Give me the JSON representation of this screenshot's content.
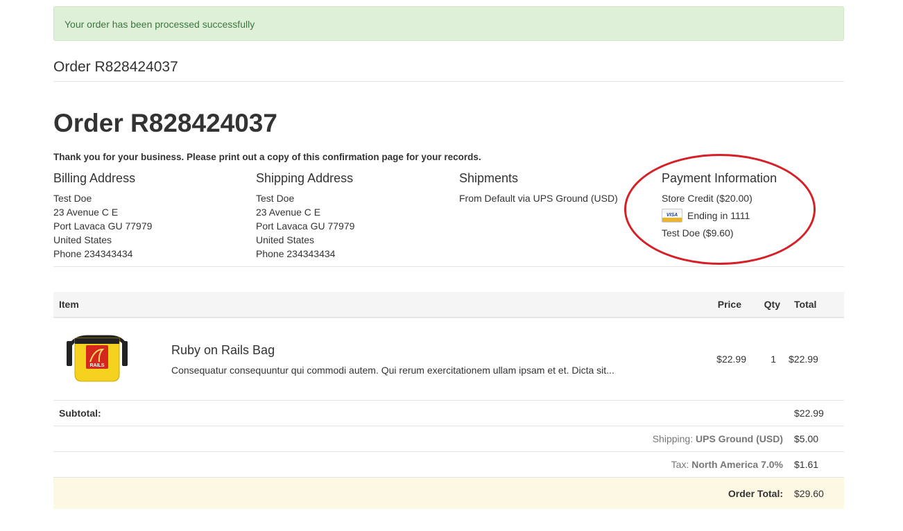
{
  "flash": {
    "message": "Your order has been processed successfully"
  },
  "breadcrumb": {
    "text": "Order R828424037"
  },
  "page": {
    "title": "Order R828424037",
    "thanks": "Thank you for your business. Please print out a copy of this confirmation page for your records."
  },
  "billing": {
    "heading": "Billing Address",
    "name": "Test Doe",
    "street": "23 Avenue C E",
    "city": "Port Lavaca GU 77979",
    "country": "United States",
    "phone": "Phone 234343434"
  },
  "shipping": {
    "heading": "Shipping Address",
    "name": "Test Doe",
    "street": "23 Avenue C E",
    "city": "Port Lavaca GU 77979",
    "country": "United States",
    "phone": "Phone 234343434"
  },
  "shipments": {
    "heading": "Shipments",
    "line": "From Default via UPS Ground (USD)"
  },
  "payment": {
    "heading": "Payment Information",
    "store_credit": "Store Credit ($20.00)",
    "card_brand": "VISA",
    "card_ending": "Ending in 1111",
    "card_holder": "Test Doe ($9.60)"
  },
  "table": {
    "headers": {
      "item": "Item",
      "price": "Price",
      "qty": "Qty",
      "total": "Total"
    },
    "items": [
      {
        "name": "Ruby on Rails Bag",
        "description": "Consequatur consequuntur qui commodi autem. Qui rerum exercitationem ullam ipsam et et. Dicta sit...",
        "image_label": "RAILS",
        "price": "$22.99",
        "qty": "1",
        "total": "$22.99"
      }
    ],
    "subtotal": {
      "label": "Subtotal:",
      "value": "$22.99"
    },
    "shipping_row": {
      "label": "Shipping:",
      "method": "UPS Ground (USD)",
      "value": "$5.00"
    },
    "tax_row": {
      "label": "Tax:",
      "name": "North America 7.0%",
      "value": "$1.61"
    },
    "order_total": {
      "label": "Order Total:",
      "value": "$29.60"
    }
  },
  "colors": {
    "success_bg": "#dff0d8",
    "success_text": "#3c763d",
    "price_blue": "#2a6496",
    "annotation_red": "#d61f26",
    "total_row_bg": "#fcf8e3"
  }
}
